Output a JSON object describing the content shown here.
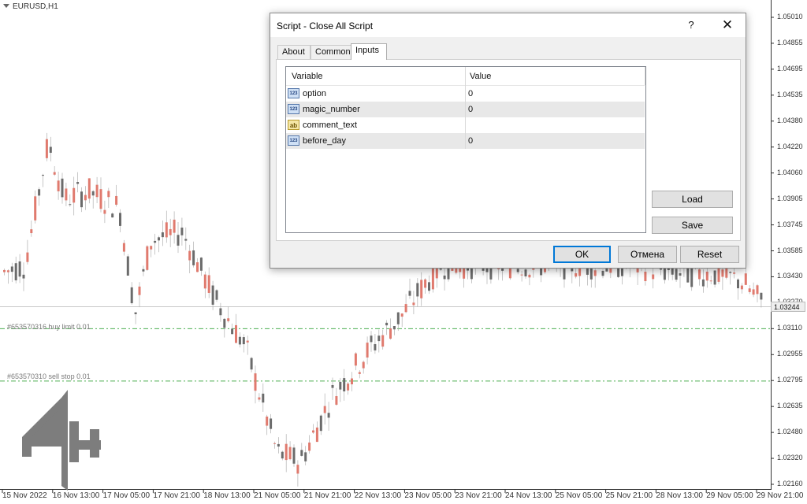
{
  "chart": {
    "symbol": "EURUSD,H1",
    "current_price": "1.03244",
    "price_labels": [
      "1.05010",
      "1.04855",
      "1.04695",
      "1.04535",
      "1.04380",
      "1.04220",
      "1.04060",
      "1.03905",
      "1.03745",
      "1.03585",
      "1.03430",
      "1.03270",
      "1.03110",
      "1.02955",
      "1.02795",
      "1.02635",
      "1.02480",
      "1.02320",
      "1.02160"
    ],
    "time_labels": [
      "15 Nov 2022",
      "16 Nov 13:00",
      "17 Nov 05:00",
      "17 Nov 21:00",
      "18 Nov 13:00",
      "21 Nov 05:00",
      "21 Nov 21:00",
      "22 Nov 13:00",
      "23 Nov 05:00",
      "23 Nov 21:00",
      "24 Nov 13:00",
      "25 Nov 05:00",
      "25 Nov 21:00",
      "28 Nov 13:00",
      "29 Nov 05:00",
      "29 Nov 21:00"
    ],
    "orders": [
      {
        "label": "#653570316 buy limit 0.01",
        "price": 1.0311
      },
      {
        "label": "#653570310 sell stop 0.01",
        "price": 1.0279
      }
    ],
    "colors": {
      "bull": "#e07a6e",
      "bear": "#6b6b6b",
      "order_line": "#4caf50",
      "grid": "#f0f0f0"
    }
  },
  "dialog": {
    "title": "Script - Close All Script",
    "help_label": "?",
    "close_label": "✕",
    "tabs": [
      "About",
      "Common",
      "Inputs"
    ],
    "active_tab": "Inputs",
    "grid_headers": {
      "variable": "Variable",
      "value": "Value"
    },
    "params": [
      {
        "icon": "123",
        "name": "option",
        "value": "0"
      },
      {
        "icon": "123",
        "name": "magic_number",
        "value": "0"
      },
      {
        "icon": "ab",
        "name": "comment_text",
        "value": ""
      },
      {
        "icon": "123",
        "name": "before_day",
        "value": "0"
      }
    ],
    "load_label": "Load",
    "save_label": "Save",
    "ok_label": "OK",
    "cancel_label": "Отмена",
    "reset_label": "Reset"
  }
}
